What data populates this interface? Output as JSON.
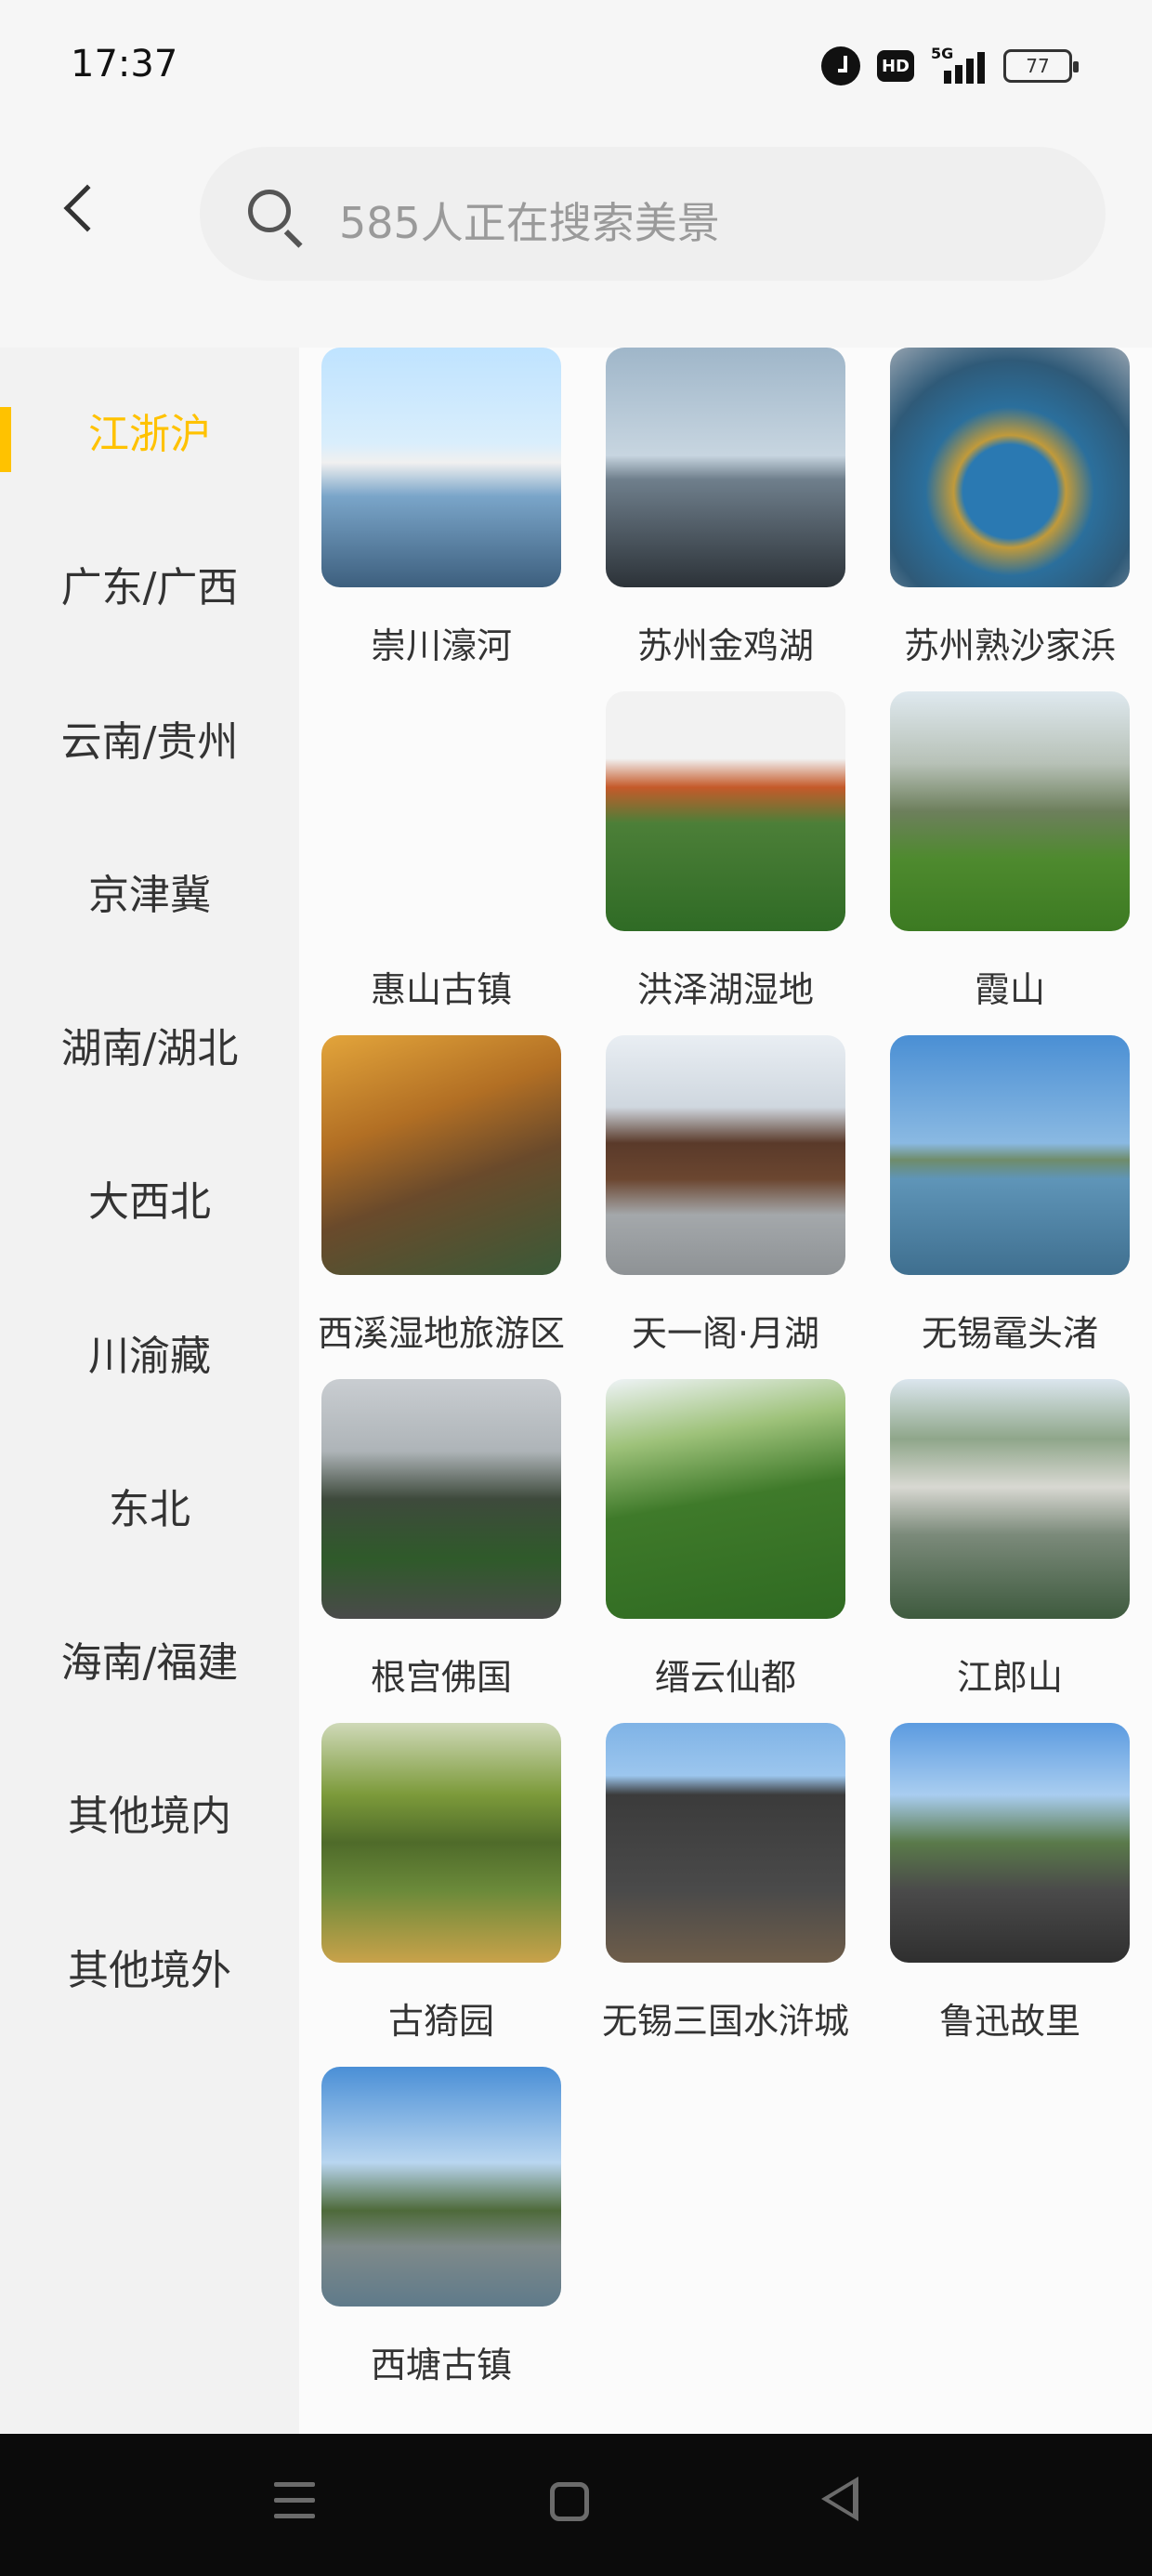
{
  "status_bar": {
    "time": "17:37",
    "hd_label": "HD",
    "network_label": "5G",
    "battery_level": "77",
    "icons": [
      "alarm-icon",
      "hd-icon",
      "5g-signal-icon",
      "battery-icon"
    ]
  },
  "header": {
    "back_icon": "chevron-left-icon",
    "search_placeholder": "585人正在搜索美景",
    "search_icon": "search-icon"
  },
  "sidebar": {
    "active_color": "#ffc200",
    "items": [
      {
        "label": "江浙沪",
        "active": true
      },
      {
        "label": "广东/广西",
        "active": false
      },
      {
        "label": "云南/贵州",
        "active": false
      },
      {
        "label": "京津冀",
        "active": false
      },
      {
        "label": "湖南/湖北",
        "active": false
      },
      {
        "label": "大西北",
        "active": false
      },
      {
        "label": "川渝藏",
        "active": false
      },
      {
        "label": "东北",
        "active": false
      },
      {
        "label": "海南/福建",
        "active": false
      },
      {
        "label": "其他境内",
        "active": false
      },
      {
        "label": "其他境外",
        "active": false
      }
    ]
  },
  "scenic_grid": {
    "items": [
      {
        "name": "崇川濠河"
      },
      {
        "name": "苏州金鸡湖"
      },
      {
        "name": "苏州熟沙家浜"
      },
      {
        "name": "惠山古镇"
      },
      {
        "name": "洪泽湖湿地"
      },
      {
        "name": "霞山"
      },
      {
        "name": "西溪湿地旅游区"
      },
      {
        "name": "天一阁·月湖"
      },
      {
        "name": "无锡鼋头渚"
      },
      {
        "name": "根宫佛国"
      },
      {
        "name": "缙云仙都"
      },
      {
        "name": "江郎山"
      },
      {
        "name": "古猗园"
      },
      {
        "name": "无锡三国水浒城"
      },
      {
        "name": "鲁迅故里"
      },
      {
        "name": "西塘古镇"
      }
    ]
  },
  "nav_bar": {
    "icons": [
      "menu-icon",
      "home-icon",
      "back-triangle-icon"
    ]
  }
}
